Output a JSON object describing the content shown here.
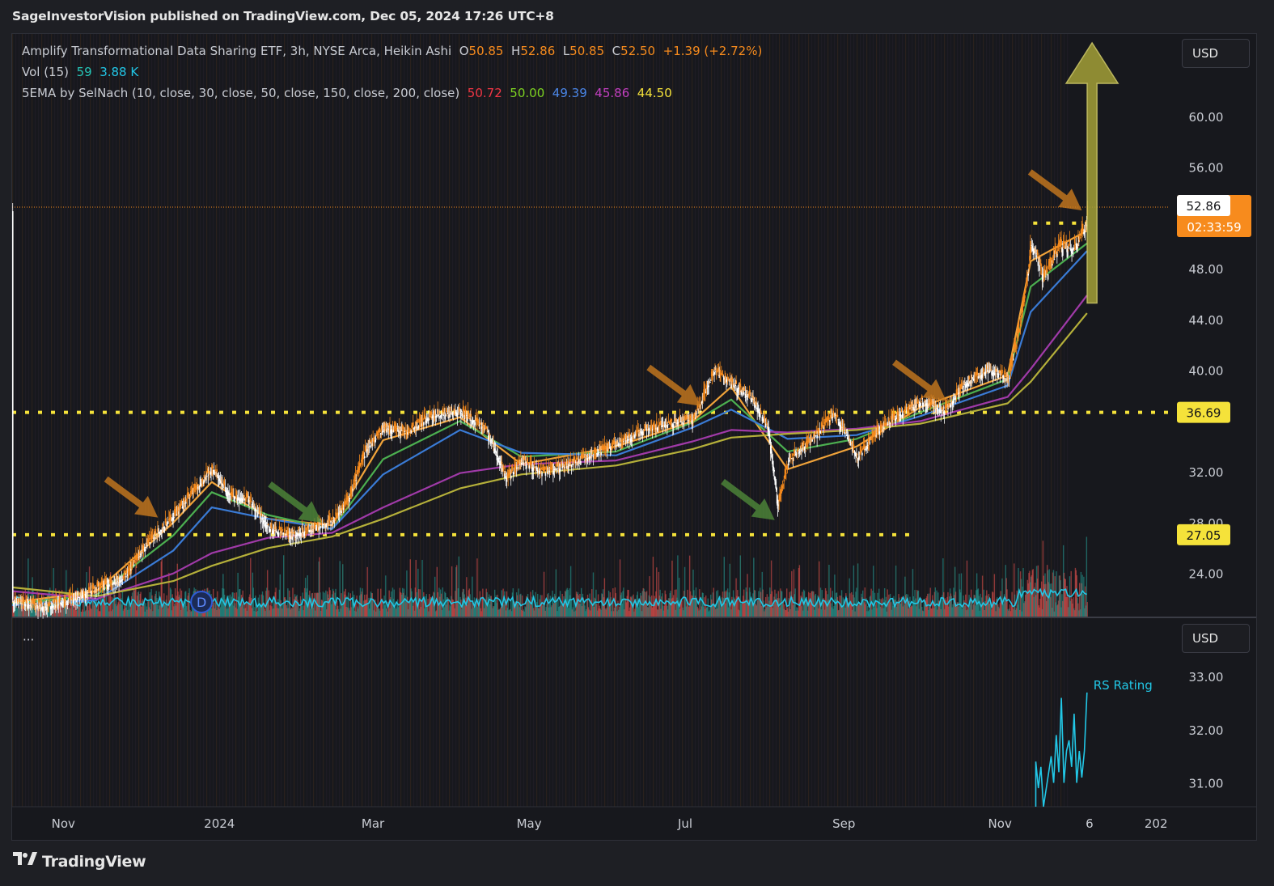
{
  "header": {
    "published_by": "SageInvestorVision published on TradingView.com, Dec 05, 2024 17:26 UTC+8"
  },
  "legend": {
    "symbol": "Amplify Transformational Data Sharing ETF, 3h, NYSE Arca, Heikin Ashi",
    "ohlc_o_label": "O",
    "ohlc_o": "50.85",
    "ohlc_h_label": "H",
    "ohlc_h": "52.86",
    "ohlc_l_label": "L",
    "ohlc_l": "50.85",
    "ohlc_c_label": "C",
    "ohlc_c": "52.50",
    "change": "+1.39 (+2.72%)",
    "vol_label": "Vol (15)",
    "vol_a": "59",
    "vol_b": "3.88 K",
    "ema_label": "5EMA by SelNach (10, close, 30, close, 50, close, 150, close, 200, close)",
    "ema_values": [
      "50.72",
      "50.00",
      "49.39",
      "45.86",
      "44.50"
    ]
  },
  "colors": {
    "ema10": "#f23645",
    "ema30": "#7ed321",
    "ema50": "#3a7bd5",
    "ema150": "#b03aa8",
    "ema200": "#e8e03a",
    "ema_lines": [
      "#f0a33a",
      "#4caf50",
      "#3a7bd5",
      "#a03aa8",
      "#b5b03a"
    ],
    "candle_up": "#f78b1d",
    "candle_down": "#ffffff",
    "volume_up": "#26a69a",
    "volume_down": "#ef5350",
    "volume_ma": "#22c7e6",
    "rs_line": "#22c7e6",
    "support_line": "#f5e23a",
    "accent_orange": "#f78b1d"
  },
  "currency_button": "USD",
  "currency_button_lower": "USD",
  "price_badges": {
    "last_price": "52.86",
    "countdown": "02:33:59",
    "level_upper": "36.69",
    "level_lower": "27.05"
  },
  "pane_menu": "···",
  "rs_label": "RS Rating",
  "footer_brand": "TradingView",
  "chart_data": {
    "type": "candlestick",
    "style": "Heikin Ashi",
    "timeframe": "3h",
    "price_axis_ticks": [
      60.0,
      56.0,
      48.0,
      44.0,
      40.0,
      32.0,
      28.0,
      24.0
    ],
    "price_axis_tick_labels": [
      "60.00",
      "56.00",
      "48.00",
      "44.00",
      "40.00",
      "32.00",
      "28.00",
      "24.00"
    ],
    "ylim": [
      20.6,
      66.5
    ],
    "rs_axis_ticks": [
      33.0,
      32.0,
      31.0
    ],
    "rs_axis_tick_labels": [
      "33.00",
      "32.00",
      "31.00"
    ],
    "rs_ylim": [
      30.55,
      34.1
    ],
    "x_tick_labels": [
      "Nov",
      "2024",
      "Mar",
      "May",
      "Jul",
      "Sep",
      "Nov",
      "6",
      "202"
    ],
    "x_tick_dates": [
      "2023-11-01",
      "2024-01-01",
      "2024-03-01",
      "2024-05-01",
      "2024-07-01",
      "2024-09-01",
      "2024-11-01",
      "2024-12-06",
      "2025-01-01"
    ],
    "xlim": [
      "2023-10-12",
      "2025-01-06"
    ],
    "close_series": [
      [
        "2023-10-12",
        21.8
      ],
      [
        "2023-10-25",
        21.4
      ],
      [
        "2023-11-04",
        22.0
      ],
      [
        "2023-11-14",
        22.9
      ],
      [
        "2023-11-24",
        23.6
      ],
      [
        "2023-12-04",
        26.5
      ],
      [
        "2023-12-14",
        28.6
      ],
      [
        "2023-12-22",
        30.6
      ],
      [
        "2023-12-29",
        32.3
      ],
      [
        "2024-01-05",
        30.1
      ],
      [
        "2024-01-12",
        29.9
      ],
      [
        "2024-01-20",
        27.6
      ],
      [
        "2024-01-28",
        27.0
      ],
      [
        "2024-02-06",
        27.6
      ],
      [
        "2024-02-14",
        28.2
      ],
      [
        "2024-02-20",
        29.8
      ],
      [
        "2024-02-27",
        33.8
      ],
      [
        "2024-03-05",
        35.5
      ],
      [
        "2024-03-14",
        35.2
      ],
      [
        "2024-03-23",
        36.4
      ],
      [
        "2024-04-04",
        36.8
      ],
      [
        "2024-04-14",
        35.3
      ],
      [
        "2024-04-22",
        31.5
      ],
      [
        "2024-04-28",
        32.9
      ],
      [
        "2024-05-06",
        32.0
      ],
      [
        "2024-05-16",
        32.6
      ],
      [
        "2024-05-26",
        33.4
      ],
      [
        "2024-06-04",
        34.2
      ],
      [
        "2024-06-14",
        35.3
      ],
      [
        "2024-06-24",
        35.8
      ],
      [
        "2024-07-04",
        36.2
      ],
      [
        "2024-07-12",
        40.0
      ],
      [
        "2024-07-19",
        39.0
      ],
      [
        "2024-07-27",
        37.8
      ],
      [
        "2024-08-02",
        35.5
      ],
      [
        "2024-08-06",
        29.4
      ],
      [
        "2024-08-10",
        32.9
      ],
      [
        "2024-08-20",
        34.8
      ],
      [
        "2024-08-28",
        36.6
      ],
      [
        "2024-09-06",
        33.2
      ],
      [
        "2024-09-14",
        35.2
      ],
      [
        "2024-09-22",
        36.5
      ],
      [
        "2024-10-01",
        37.6
      ],
      [
        "2024-10-10",
        36.8
      ],
      [
        "2024-10-18",
        39.0
      ],
      [
        "2024-10-27",
        40.1
      ],
      [
        "2024-11-04",
        39.4
      ],
      [
        "2024-11-09",
        44.0
      ],
      [
        "2024-11-13",
        50.0
      ],
      [
        "2024-11-18",
        47.3
      ],
      [
        "2024-11-24",
        49.8
      ],
      [
        "2024-11-29",
        49.6
      ],
      [
        "2024-12-04",
        51.2
      ],
      [
        "2024-12-05",
        52.5
      ]
    ],
    "ema_lines": [
      {
        "period": 10,
        "points": [
          [
            "2023-10-12",
            21.7
          ],
          [
            "2023-11-14",
            22.6
          ],
          [
            "2023-12-14",
            28.0
          ],
          [
            "2023-12-29",
            31.2
          ],
          [
            "2024-01-20",
            28.3
          ],
          [
            "2024-02-14",
            27.8
          ],
          [
            "2024-03-05",
            34.5
          ],
          [
            "2024-04-04",
            36.3
          ],
          [
            "2024-04-28",
            32.6
          ],
          [
            "2024-06-04",
            34.0
          ],
          [
            "2024-07-04",
            36.0
          ],
          [
            "2024-07-19",
            38.7
          ],
          [
            "2024-08-10",
            32.2
          ],
          [
            "2024-09-06",
            34.0
          ],
          [
            "2024-10-01",
            37.1
          ],
          [
            "2024-11-04",
            39.6
          ],
          [
            "2024-11-13",
            48.6
          ],
          [
            "2024-12-05",
            51.0
          ]
        ]
      },
      {
        "period": 30,
        "points": [
          [
            "2023-10-12",
            21.6
          ],
          [
            "2023-11-14",
            22.3
          ],
          [
            "2023-12-14",
            27.0
          ],
          [
            "2023-12-29",
            30.4
          ],
          [
            "2024-01-20",
            28.6
          ],
          [
            "2024-02-14",
            27.5
          ],
          [
            "2024-03-05",
            33.0
          ],
          [
            "2024-04-04",
            36.0
          ],
          [
            "2024-04-28",
            33.2
          ],
          [
            "2024-06-04",
            33.6
          ],
          [
            "2024-07-04",
            35.9
          ],
          [
            "2024-07-19",
            37.7
          ],
          [
            "2024-08-10",
            33.6
          ],
          [
            "2024-09-06",
            34.6
          ],
          [
            "2024-10-01",
            36.7
          ],
          [
            "2024-11-04",
            39.3
          ],
          [
            "2024-11-13",
            46.6
          ],
          [
            "2024-12-05",
            50.0
          ]
        ]
      },
      {
        "period": 50,
        "points": [
          [
            "2023-10-12",
            21.5
          ],
          [
            "2023-11-14",
            21.9
          ],
          [
            "2023-12-14",
            25.8
          ],
          [
            "2023-12-29",
            29.2
          ],
          [
            "2024-01-20",
            28.3
          ],
          [
            "2024-02-14",
            27.5
          ],
          [
            "2024-03-05",
            31.8
          ],
          [
            "2024-04-04",
            35.3
          ],
          [
            "2024-04-28",
            33.5
          ],
          [
            "2024-06-04",
            33.3
          ],
          [
            "2024-07-04",
            35.5
          ],
          [
            "2024-07-19",
            36.9
          ],
          [
            "2024-08-10",
            34.6
          ],
          [
            "2024-09-06",
            34.9
          ],
          [
            "2024-10-01",
            36.4
          ],
          [
            "2024-11-04",
            38.8
          ],
          [
            "2024-11-13",
            44.6
          ],
          [
            "2024-12-05",
            49.4
          ]
        ]
      },
      {
        "period": 150,
        "points": [
          [
            "2023-10-12",
            22.6
          ],
          [
            "2023-11-14",
            22.0
          ],
          [
            "2023-12-14",
            24.0
          ],
          [
            "2023-12-29",
            25.6
          ],
          [
            "2024-01-20",
            26.8
          ],
          [
            "2024-02-14",
            27.2
          ],
          [
            "2024-03-05",
            29.2
          ],
          [
            "2024-04-04",
            31.9
          ],
          [
            "2024-04-28",
            32.6
          ],
          [
            "2024-06-04",
            32.9
          ],
          [
            "2024-07-04",
            34.4
          ],
          [
            "2024-07-19",
            35.3
          ],
          [
            "2024-08-10",
            35.1
          ],
          [
            "2024-09-06",
            35.4
          ],
          [
            "2024-10-01",
            36.0
          ],
          [
            "2024-11-04",
            37.9
          ],
          [
            "2024-11-13",
            40.1
          ],
          [
            "2024-12-05",
            45.9
          ]
        ]
      },
      {
        "period": 200,
        "points": [
          [
            "2023-10-12",
            22.9
          ],
          [
            "2023-11-14",
            22.2
          ],
          [
            "2023-12-14",
            23.4
          ],
          [
            "2023-12-29",
            24.6
          ],
          [
            "2024-01-20",
            26.0
          ],
          [
            "2024-02-14",
            26.9
          ],
          [
            "2024-03-05",
            28.3
          ],
          [
            "2024-04-04",
            30.7
          ],
          [
            "2024-04-28",
            31.8
          ],
          [
            "2024-06-04",
            32.5
          ],
          [
            "2024-07-04",
            33.8
          ],
          [
            "2024-07-19",
            34.7
          ],
          [
            "2024-08-10",
            35.0
          ],
          [
            "2024-09-06",
            35.3
          ],
          [
            "2024-10-01",
            35.8
          ],
          [
            "2024-11-04",
            37.4
          ],
          [
            "2024-11-13",
            39.1
          ],
          [
            "2024-12-05",
            44.5
          ]
        ]
      }
    ],
    "horizontal_levels": [
      {
        "price": 36.69,
        "style": "dotted",
        "from": "2023-10-12",
        "to": "2025-01-06"
      },
      {
        "price": 27.05,
        "style": "dotted",
        "from": "2023-10-12",
        "to": "2024-09-29"
      },
      {
        "price": 51.6,
        "style": "dotted",
        "from": "2024-11-14",
        "to": "2024-12-05"
      },
      {
        "price": 52.86,
        "style": "thin",
        "from": "2023-10-12",
        "to": "2025-01-06"
      }
    ],
    "annotations": [
      {
        "type": "arrow",
        "color": "orange",
        "direction": "down-right",
        "target_date": "2023-12-08",
        "target_price": 28.4
      },
      {
        "type": "arrow",
        "color": "green",
        "direction": "down-right",
        "target_date": "2024-02-10",
        "target_price": 28.0
      },
      {
        "type": "arrow",
        "color": "orange",
        "direction": "down-right",
        "target_date": "2024-07-07",
        "target_price": 37.2
      },
      {
        "type": "arrow",
        "color": "green",
        "direction": "down-right",
        "target_date": "2024-08-05",
        "target_price": 28.2
      },
      {
        "type": "arrow",
        "color": "orange",
        "direction": "down-right",
        "target_date": "2024-10-11",
        "target_price": 37.6
      },
      {
        "type": "arrow",
        "color": "orange",
        "direction": "down-right",
        "target_date": "2024-12-03",
        "target_price": 52.6
      },
      {
        "type": "arrow",
        "color": "olive",
        "direction": "up",
        "target_date": "2024-12-07",
        "target_price": 65.8
      }
    ],
    "event_marker": {
      "label": "D",
      "date": "2023-12-25"
    },
    "rs_rating": {
      "name": "RS Rating",
      "points": [
        [
          "2024-11-15",
          30.55
        ],
        [
          "2024-11-15",
          31.4
        ],
        [
          "2024-11-16",
          30.9
        ],
        [
          "2024-11-17",
          31.3
        ],
        [
          "2024-11-18",
          30.55
        ],
        [
          "2024-11-21",
          31.5
        ],
        [
          "2024-11-22",
          31.0
        ],
        [
          "2024-11-23",
          31.9
        ],
        [
          "2024-11-24",
          31.2
        ],
        [
          "2024-11-25",
          32.6
        ],
        [
          "2024-11-26",
          31.0
        ],
        [
          "2024-11-27",
          31.6
        ],
        [
          "2024-11-28",
          31.8
        ],
        [
          "2024-11-29",
          31.3
        ],
        [
          "2024-11-30",
          32.3
        ],
        [
          "2024-12-01",
          31.0
        ],
        [
          "2024-12-02",
          31.6
        ],
        [
          "2024-12-03",
          31.1
        ],
        [
          "2024-12-04",
          31.6
        ],
        [
          "2024-12-05",
          32.7
        ]
      ]
    }
  }
}
